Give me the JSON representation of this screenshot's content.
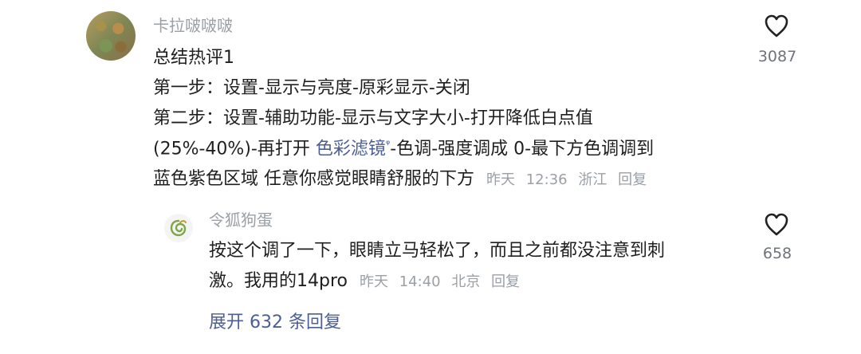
{
  "main_comment": {
    "username": "卡拉啵啵啵",
    "lines": [
      "总结热评1",
      "第一步：设置-显示与亮度-原彩显示-关闭",
      "第二步：设置-辅助功能-显示与文字大小-打开降低白点值",
      "(25%-40%)-再打开 ",
      "-色调-强度调成 0-最下方色调调到",
      "蓝色紫色区域 任意你感觉眼睛舒服的下方"
    ],
    "link_text": "色彩滤镜",
    "meta": {
      "date": "昨天",
      "time": "12:36",
      "location": "浙江",
      "reply": "回复"
    },
    "likes": "3087"
  },
  "reply_comment": {
    "username": "令狐狗蛋",
    "lines": [
      "按这个调了一下，眼睛立马轻松了，而且之前都没注意到刺",
      "激。我用的14pro"
    ],
    "meta": {
      "date": "昨天",
      "time": "14:40",
      "location": "北京",
      "reply": "回复"
    },
    "likes": "658"
  },
  "expand_replies": "展开 632 条回复",
  "colors": {
    "text": "#1f1f1f",
    "muted": "#9aa0a6",
    "link": "#4b5f96"
  },
  "icons": [
    "heart-outline-icon",
    "search-icon",
    "spiral-avatar-icon"
  ]
}
